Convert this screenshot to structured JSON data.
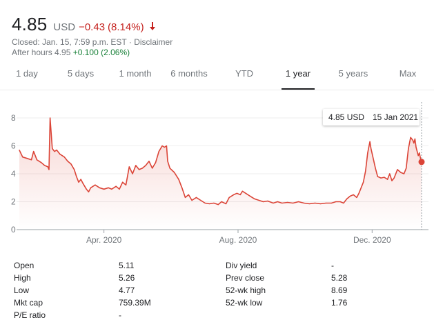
{
  "quote": {
    "price": "4.85",
    "currency": "USD",
    "change": "−0.43",
    "change_pct": "(8.14%)",
    "closed_text": "Closed: Jan. 15, 7:59 p.m. EST · Disclaimer",
    "after_hours_label": "After hours 4.95",
    "after_hours_change": "+0.100 (2.06%)",
    "negative_color": "#c5221f",
    "positive_color": "#188038",
    "direction_icon": "arrow-down-icon"
  },
  "tabs": [
    {
      "label": "1 day",
      "active": false
    },
    {
      "label": "5 days",
      "active": false
    },
    {
      "label": "1 month",
      "active": false
    },
    {
      "label": "6 months",
      "active": false
    },
    {
      "label": "YTD",
      "active": false
    },
    {
      "label": "1 year",
      "active": true
    },
    {
      "label": "5 years",
      "active": false
    },
    {
      "label": "Max",
      "active": false
    }
  ],
  "tooltip": {
    "value": "4.85 USD",
    "date": "15 Jan 2021"
  },
  "chart_data": {
    "type": "area",
    "title": "",
    "xlabel": "",
    "ylabel": "",
    "ylim": [
      0,
      8
    ],
    "yticks": [
      "0",
      "2",
      "4",
      "6",
      "8"
    ],
    "xticks": [
      {
        "label": "Apr. 2020",
        "x": "2020-04-01"
      },
      {
        "label": "Aug. 2020",
        "x": "2020-08-01"
      },
      {
        "label": "Dec. 2020",
        "x": "2020-12-01"
      }
    ],
    "xlim": [
      "2020-01-15",
      "2021-01-15"
    ],
    "line_color": "#db4437",
    "grid": true,
    "series": [
      {
        "points": [
          [
            "2020-01-15",
            5.7
          ],
          [
            "2020-01-18",
            5.2
          ],
          [
            "2020-01-22",
            5.1
          ],
          [
            "2020-01-26",
            5.0
          ],
          [
            "2020-01-28",
            5.6
          ],
          [
            "2020-01-31",
            5.0
          ],
          [
            "2020-02-04",
            4.8
          ],
          [
            "2020-02-07",
            4.6
          ],
          [
            "2020-02-10",
            4.5
          ],
          [
            "2020-02-11",
            4.3
          ],
          [
            "2020-02-12",
            8.0
          ],
          [
            "2020-02-14",
            5.8
          ],
          [
            "2020-02-16",
            5.6
          ],
          [
            "2020-02-18",
            5.7
          ],
          [
            "2020-02-21",
            5.4
          ],
          [
            "2020-02-25",
            5.2
          ],
          [
            "2020-02-28",
            4.9
          ],
          [
            "2020-03-02",
            4.7
          ],
          [
            "2020-03-05",
            4.3
          ],
          [
            "2020-03-07",
            3.8
          ],
          [
            "2020-03-09",
            3.4
          ],
          [
            "2020-03-11",
            3.6
          ],
          [
            "2020-03-13",
            3.3
          ],
          [
            "2020-03-16",
            2.9
          ],
          [
            "2020-03-18",
            2.7
          ],
          [
            "2020-03-20",
            3.0
          ],
          [
            "2020-03-24",
            3.2
          ],
          [
            "2020-03-28",
            3.0
          ],
          [
            "2020-04-01",
            2.9
          ],
          [
            "2020-04-05",
            3.0
          ],
          [
            "2020-04-08",
            2.9
          ],
          [
            "2020-04-12",
            3.1
          ],
          [
            "2020-04-15",
            2.9
          ],
          [
            "2020-04-18",
            3.4
          ],
          [
            "2020-04-21",
            3.2
          ],
          [
            "2020-04-24",
            4.5
          ],
          [
            "2020-04-27",
            4.0
          ],
          [
            "2020-04-30",
            4.6
          ],
          [
            "2020-05-03",
            4.3
          ],
          [
            "2020-05-06",
            4.4
          ],
          [
            "2020-05-09",
            4.6
          ],
          [
            "2020-05-12",
            4.9
          ],
          [
            "2020-05-15",
            4.4
          ],
          [
            "2020-05-18",
            4.8
          ],
          [
            "2020-05-21",
            5.6
          ],
          [
            "2020-05-24",
            6.0
          ],
          [
            "2020-05-26",
            5.9
          ],
          [
            "2020-05-28",
            6.0
          ],
          [
            "2020-05-29",
            4.9
          ],
          [
            "2020-05-31",
            4.4
          ],
          [
            "2020-06-04",
            4.1
          ],
          [
            "2020-06-08",
            3.6
          ],
          [
            "2020-06-11",
            3.0
          ],
          [
            "2020-06-14",
            2.3
          ],
          [
            "2020-06-17",
            2.5
          ],
          [
            "2020-06-20",
            2.1
          ],
          [
            "2020-06-24",
            2.3
          ],
          [
            "2020-06-28",
            2.1
          ],
          [
            "2020-07-02",
            1.9
          ],
          [
            "2020-07-06",
            1.85
          ],
          [
            "2020-07-10",
            1.9
          ],
          [
            "2020-07-14",
            1.8
          ],
          [
            "2020-07-17",
            2.0
          ],
          [
            "2020-07-21",
            1.85
          ],
          [
            "2020-07-24",
            2.3
          ],
          [
            "2020-07-28",
            2.5
          ],
          [
            "2020-07-31",
            2.6
          ],
          [
            "2020-08-03",
            2.5
          ],
          [
            "2020-08-05",
            2.75
          ],
          [
            "2020-08-08",
            2.6
          ],
          [
            "2020-08-12",
            2.4
          ],
          [
            "2020-08-16",
            2.2
          ],
          [
            "2020-08-20",
            2.1
          ],
          [
            "2020-08-24",
            2.0
          ],
          [
            "2020-08-28",
            2.05
          ],
          [
            "2020-09-02",
            1.9
          ],
          [
            "2020-09-06",
            2.0
          ],
          [
            "2020-09-10",
            1.9
          ],
          [
            "2020-09-15",
            1.95
          ],
          [
            "2020-09-20",
            1.9
          ],
          [
            "2020-09-25",
            2.0
          ],
          [
            "2020-09-30",
            1.9
          ],
          [
            "2020-10-05",
            1.85
          ],
          [
            "2020-10-10",
            1.9
          ],
          [
            "2020-10-15",
            1.85
          ],
          [
            "2020-10-20",
            1.9
          ],
          [
            "2020-10-25",
            1.9
          ],
          [
            "2020-10-29",
            2.0
          ],
          [
            "2020-11-02",
            2.0
          ],
          [
            "2020-11-05",
            1.9
          ],
          [
            "2020-11-08",
            2.2
          ],
          [
            "2020-11-11",
            2.4
          ],
          [
            "2020-11-14",
            2.5
          ],
          [
            "2020-11-17",
            2.3
          ],
          [
            "2020-11-19",
            2.6
          ],
          [
            "2020-11-22",
            3.2
          ],
          [
            "2020-11-23",
            3.4
          ],
          [
            "2020-11-25",
            4.2
          ],
          [
            "2020-11-27",
            5.5
          ],
          [
            "2020-11-29",
            6.3
          ],
          [
            "2020-11-30",
            5.8
          ],
          [
            "2020-12-02",
            5.1
          ],
          [
            "2020-12-04",
            4.4
          ],
          [
            "2020-12-06",
            3.8
          ],
          [
            "2020-12-09",
            3.7
          ],
          [
            "2020-12-12",
            3.75
          ],
          [
            "2020-12-15",
            3.6
          ],
          [
            "2020-12-17",
            4.0
          ],
          [
            "2020-12-19",
            3.5
          ],
          [
            "2020-12-21",
            3.7
          ],
          [
            "2020-12-24",
            4.3
          ],
          [
            "2020-12-27",
            4.1
          ],
          [
            "2020-12-30",
            4.0
          ],
          [
            "2021-01-01",
            4.4
          ],
          [
            "2021-01-03",
            5.8
          ],
          [
            "2021-01-05",
            6.6
          ],
          [
            "2021-01-07",
            6.4
          ],
          [
            "2021-01-08",
            6.2
          ],
          [
            "2021-01-09",
            6.5
          ],
          [
            "2021-01-10",
            5.9
          ],
          [
            "2021-01-12",
            5.3
          ],
          [
            "2021-01-13",
            5.5
          ],
          [
            "2021-01-14",
            5.1
          ],
          [
            "2021-01-15",
            4.85
          ]
        ]
      }
    ]
  },
  "stats": {
    "left": [
      {
        "label": "Open",
        "value": "5.11"
      },
      {
        "label": "High",
        "value": "5.26"
      },
      {
        "label": "Low",
        "value": "4.77"
      },
      {
        "label": "Mkt cap",
        "value": "759.39M"
      },
      {
        "label": "P/E ratio",
        "value": "-"
      }
    ],
    "right": [
      {
        "label": "Div yield",
        "value": "-"
      },
      {
        "label": "Prev close",
        "value": "5.28"
      },
      {
        "label": "52-wk high",
        "value": "8.69"
      },
      {
        "label": "52-wk low",
        "value": "1.76"
      }
    ]
  }
}
